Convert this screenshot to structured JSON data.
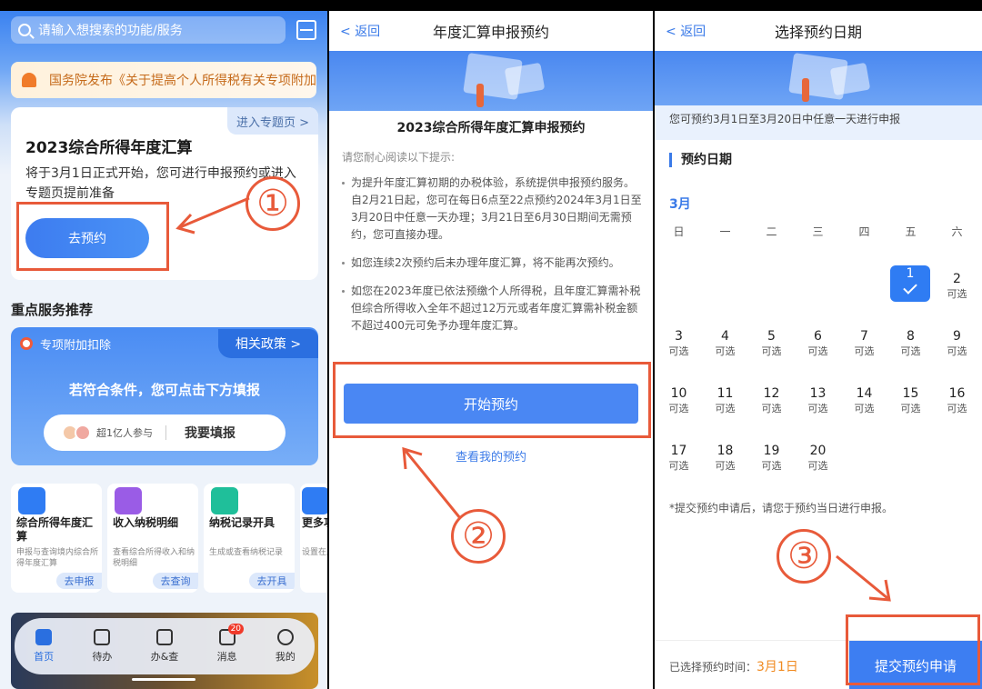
{
  "panel1": {
    "search_placeholder": "请输入想搜索的功能/服务",
    "notice": "国务院发布《关于提高个人所得税有关专项附加",
    "card": {
      "link": "进入专题页 >",
      "title": "2023综合所得年度汇算",
      "desc": "将于3月1日正式开始，您可进行申报预约或进入专题页提前准备",
      "button": "去预约"
    },
    "section_title": "重点服务推荐",
    "promo": {
      "tag": "专项附加扣除",
      "policy": "相关政策 >",
      "text": "若符合条件，您可点击下方填报",
      "participants": "超1亿人参与",
      "action": "我要填报"
    },
    "services": [
      {
        "title": "综合所得年度汇算",
        "desc": "申报与查询境内综合所得年度汇算",
        "action": "去申报",
        "color": "#2f7cf3"
      },
      {
        "title": "收入纳税明细",
        "desc": "查看综合所得收入和纳税明细",
        "action": "去查询",
        "color": "#9a5ce6"
      },
      {
        "title": "纳税记录开具",
        "desc": "生成或查看纳税记录",
        "action": "去开具",
        "color": "#1fbf9a"
      },
      {
        "title": "更多功",
        "desc": "设置在用功能",
        "action": "",
        "color": "#2f7cf3"
      }
    ],
    "tabs": [
      {
        "label": "首页",
        "active": true
      },
      {
        "label": "待办",
        "active": false
      },
      {
        "label": "办&查",
        "active": false
      },
      {
        "label": "消息",
        "active": false,
        "badge": "20"
      },
      {
        "label": "我的",
        "active": false
      }
    ]
  },
  "panel2": {
    "back": "返回",
    "title": "年度汇算申报预约",
    "heading": "2023综合所得年度汇算申报预约",
    "intro": "请您耐心阅读以下提示:",
    "items": [
      "为提升年度汇算初期的办税体验，系统提供申报预约服务。自2月21日起，您可在每日6点至22点预约2024年3月1日至3月20日中任意一天办理；3月21日至6月30日期间无需预约，您可直接办理。",
      "如您连续2次预约后未办理年度汇算，将不能再次预约。",
      "如您在2023年度已依法预缴个人所得税，且年度汇算需补税但综合所得收入全年不超过12万元或者年度汇算需补税金额不超过400元可免予办理年度汇算。"
    ],
    "start_button": "开始预约",
    "my_link": "查看我的预约"
  },
  "panel3": {
    "back": "返回",
    "title": "选择预约日期",
    "hint": "您可预约3月1日至3月20日中任意一天进行申报",
    "section": "预约日期",
    "month": "3月",
    "weekdays": [
      "日",
      "一",
      "二",
      "三",
      "四",
      "五",
      "六"
    ],
    "days_label": "可选",
    "footnote": "*提交预约申请后，请您于预约当日进行申报。",
    "chosen_label": "已选择预约时间：",
    "chosen_value": "3月1日",
    "submit": "提交预约申请"
  },
  "annotations": [
    "①",
    "②",
    "③"
  ]
}
